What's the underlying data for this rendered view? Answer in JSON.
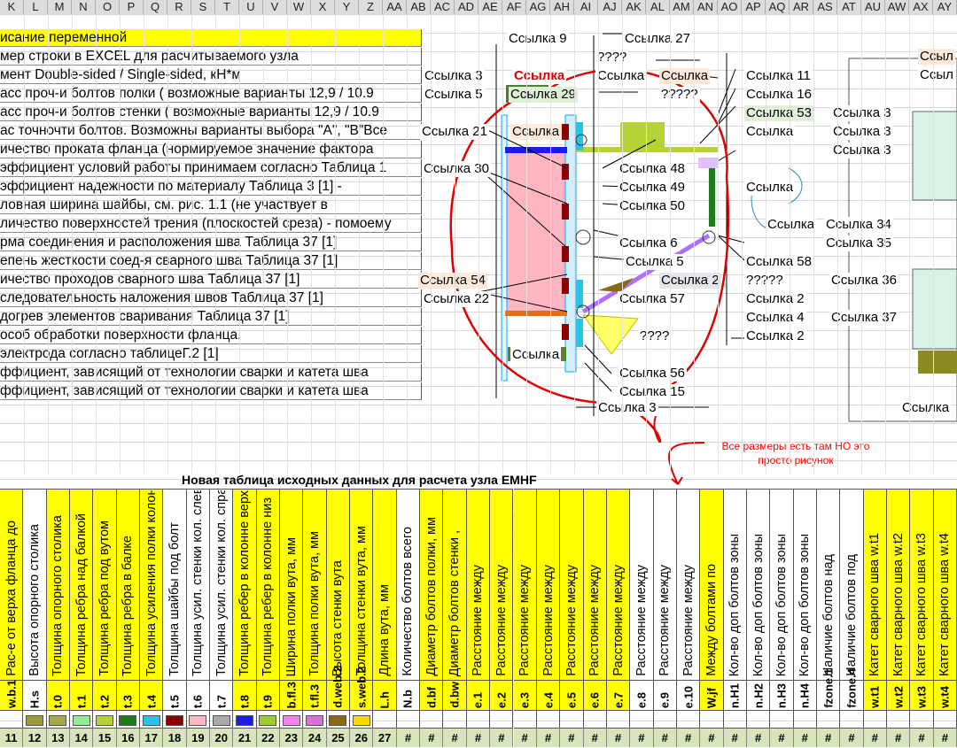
{
  "columns": [
    "K",
    "L",
    "M",
    "N",
    "O",
    "P",
    "Q",
    "R",
    "S",
    "T",
    "U",
    "V",
    "W",
    "X",
    "Y",
    "Z",
    "AA",
    "AB",
    "AC",
    "AD",
    "AE",
    "AF",
    "AG",
    "AH",
    "AI",
    "AJ",
    "AK",
    "AL",
    "AM",
    "AN",
    "AO",
    "AP",
    "AQ",
    "AR",
    "AS",
    "AT",
    "AU",
    "AW",
    "AX",
    "AY"
  ],
  "descriptions": [
    "исание переменной",
    "мер строки в EXCEL для расчитываемого узла",
    "мент Double-sided / Single-sided, кН*м",
    "асс проч-и болтов полки ( возможные варианты 12,9 / 10.9",
    "асс проч-и болтов стенки ( возможные варианты 12,9 / 10.9",
    "ас точночти болтов. Возможны варианты выбора \"A\", \"B\"Все",
    "ичество проката фланца (нормируемое значение фактора",
    "эффициент условий работы принимаем согласно Таблица 1",
    "эффициент надежности по материалу Таблица 3 [1] -",
    "ловная ширина шайбы, см. рис. 1.1 (не участвует в",
    "личество поверхностей трения (плоскостей среза) - помоему",
    "рма соединения и расположения  шва Таблица 37 [1]",
    "епень жесткости соед-я сварного шва Таблица 37 [1]",
    "ичество проходов сварного шва Таблица 37 [1]",
    "следовательность наложения швов Таблица 37 [1]",
    "догрев элементов сваривания Таблица 37 [1]",
    "особ обработки поверхности фланца.",
    " электрода согласно таблицеГ.2 [1]",
    "ффициент, зависящий от технологии сварки и катета шва",
    "ффициент, зависящий от технологии сварки и катета шва"
  ],
  "drawing_labels": {
    "l1": "Ссылка 9",
    "l2": "Ссылка 27",
    "l3": "????",
    "l4": "Ссылка 3",
    "l5": "Ссылка",
    "l6": "Ссылка",
    "l7": "Ссылка",
    "l8": "Ссылка 11",
    "l9": "Ссылка 5",
    "l10": "Ссылка 29",
    "l11": "?????",
    "l12": "Ссылка 16",
    "l13": "Ссылка 53",
    "l14": "Ссылка 21",
    "l15": "Ссылка",
    "l16": "Ссылка",
    "l17": "Ссылка 30",
    "l18": "Ссылка 48",
    "l19": "Ссылка 49",
    "l20": "Ссылка",
    "l21": "Ссылка 50",
    "l22": "Ссылка",
    "l23": "Ссылка 6",
    "l24": "Ссылка 5",
    "l25": "Ссылка 58",
    "l26": "Ссылка 54",
    "l27": "Ссылка 2",
    "l28": "?????",
    "l29": "Ссылка 22",
    "l30": "Ссылка 57",
    "l31": "Ссылка 2",
    "l32": "Ссылка 4",
    "l33": "????",
    "l34": "Ссылка 2",
    "l35": "Ссылка",
    "l36": "Ссылка 56",
    "l37": "Ссылка 15",
    "l38": "Ссылка 3",
    "r1": "Ссыл",
    "r2": "Ссыл",
    "r3": "Ссылка 3",
    "r4": "Ссылка 3",
    "r5": "Ссылка 3",
    "r6": "Ссылка 34",
    "r7": "Ссылка 35",
    "r8": "Ссылка 36",
    "r9": "Ссылка 37",
    "r10": "Ссылка"
  },
  "note": "Все размеры есть там НО это просто рисунок",
  "table_title": "Новая таблица исходных данных для расчета узла EMHF",
  "table_columns": [
    {
      "header": "Рас-е от верха фланца до",
      "code": "w.b.1",
      "bg": "#ffff00",
      "swatch": "",
      "num": "11"
    },
    {
      "header": "Высота опорного столика",
      "code": "H.s",
      "bg": "#ffffff",
      "swatch": "#9c9c3c",
      "num": "12"
    },
    {
      "header": "Толщина опорного столика",
      "code": "t.0",
      "bg": "#ffff00",
      "swatch": "#a6a64a",
      "num": "13"
    },
    {
      "header": "Толщина ребра над балкой",
      "code": "t.1",
      "bg": "#ffff00",
      "swatch": "#90ee90",
      "num": "14"
    },
    {
      "header": "Толщина ребра под вутом",
      "code": "t.2",
      "bg": "#ffff00",
      "swatch": "#b5d334",
      "num": "15"
    },
    {
      "header": "Толщина ребра в балке",
      "code": "t.3",
      "bg": "#ffff00",
      "swatch": "#1e7b1e",
      "num": "16"
    },
    {
      "header": "Толщина усиления полки колонны",
      "code": "t.4",
      "bg": "#ffff00",
      "swatch": "#27c4e8",
      "num": "17"
    },
    {
      "header": "Толщина шайбы под болт",
      "code": "t.5",
      "bg": "#ffffff",
      "swatch": "#8b0000",
      "num": "18"
    },
    {
      "header": "Толщина усил. стенки кол. слева",
      "code": "t.6",
      "bg": "#ffffff",
      "swatch": "#ffb6c1",
      "num": "19"
    },
    {
      "header": "Толщина усил. стенки кол. справа",
      "code": "t.7",
      "bg": "#ffffff",
      "swatch": "#a9a9a9",
      "num": "20"
    },
    {
      "header": "Толщина ребер в колонне верх",
      "code": "t.8",
      "bg": "#ffff00",
      "swatch": "#1c1ce8",
      "num": "21"
    },
    {
      "header": "Толщина ребер в колонне низ",
      "code": "t.9",
      "bg": "#ffff00",
      "swatch": "#9acd32",
      "num": "22"
    },
    {
      "header": "Ширина полки вута, мм",
      "code": "b.fl.3",
      "bg": "#ffff00",
      "swatch": "#ee82ee",
      "num": "23"
    },
    {
      "header": "Толщина полки вута, мм",
      "code": "t.fl.3",
      "bg": "#ffff00",
      "swatch": "#da70d6",
      "num": "24"
    },
    {
      "header": "Высота стенки вута",
      "code": "d.web.2",
      "bg": "#ffff00",
      "swatch": "#8b6914",
      "num": "25"
    },
    {
      "header": "Толщина стенки вута, мм",
      "code": "s.web.2",
      "bg": "#ffff00",
      "swatch": "#ffd700",
      "num": "26"
    },
    {
      "header": "Длина вута, мм",
      "code": "L.h",
      "bg": "#ffff00",
      "swatch": "",
      "num": "27"
    },
    {
      "header": "Количество болтов всего",
      "code": "N.b",
      "bg": "#ffffff",
      "swatch": "",
      "num": "#"
    },
    {
      "header": "Диаметр болтов полки, мм",
      "code": "d.bf",
      "bg": "#ffff00",
      "swatch": "",
      "num": "#"
    },
    {
      "header": "Диаметр болтов стенки ,",
      "code": "d.bw",
      "bg": "#ffff00",
      "swatch": "",
      "num": "#"
    },
    {
      "header": "Расстояние между",
      "code": "e.1",
      "bg": "#ffff00",
      "swatch": "",
      "num": "#"
    },
    {
      "header": "Расстояние между",
      "code": "e.2",
      "bg": "#ffff00",
      "swatch": "",
      "num": "#"
    },
    {
      "header": "Расстояние между",
      "code": "e.3",
      "bg": "#ffff00",
      "swatch": "",
      "num": "#"
    },
    {
      "header": "Расстояние между",
      "code": "e.4",
      "bg": "#ffff00",
      "swatch": "",
      "num": "#"
    },
    {
      "header": "Расстояние между",
      "code": "e.5",
      "bg": "#ffff00",
      "swatch": "",
      "num": "#"
    },
    {
      "header": "Расстояние между",
      "code": "e.6",
      "bg": "#ffff00",
      "swatch": "",
      "num": "#"
    },
    {
      "header": "Расстояние между",
      "code": "e.7",
      "bg": "#ffff00",
      "swatch": "",
      "num": "#"
    },
    {
      "header": "Расстояние между",
      "code": "e.8",
      "bg": "#ffffff",
      "swatch": "",
      "num": "#"
    },
    {
      "header": "Расстояние между",
      "code": "e.9",
      "bg": "#ffffff",
      "swatch": "",
      "num": "#"
    },
    {
      "header": "Расстояние между",
      "code": "e.10",
      "bg": "#ffffff",
      "swatch": "",
      "num": "#"
    },
    {
      "header": "Между болтами по",
      "code": "W.jf",
      "bg": "#ffff00",
      "swatch": "",
      "num": "#"
    },
    {
      "header": "Кол-во доп болтов зоны",
      "code": "n.H1",
      "bg": "#ffffff",
      "swatch": "",
      "num": "#"
    },
    {
      "header": "Кол-во доп болтов зоны",
      "code": "n.H2",
      "bg": "#ffffff",
      "swatch": "",
      "num": "#"
    },
    {
      "header": "Кол-во доп болтов зоны",
      "code": "n.H3",
      "bg": "#ffffff",
      "swatch": "",
      "num": "#"
    },
    {
      "header": "Кол-во доп болтов зоны",
      "code": "n.H4",
      "bg": "#ffffff",
      "swatch": "",
      "num": "#"
    },
    {
      "header": "Наличие болтов над",
      "code": "fzone.1",
      "bg": "#ffffff",
      "swatch": "",
      "num": "#"
    },
    {
      "header": "Наличие болтов под",
      "code": "fzone.4",
      "bg": "#ffffff",
      "swatch": "",
      "num": "#"
    },
    {
      "header": "Катет сварного шва  w.t1",
      "code": "w.t1",
      "bg": "#ffff00",
      "swatch": "",
      "num": "#"
    },
    {
      "header": "Катет сварного шва  w.t2",
      "code": "w.t2",
      "bg": "#ffff00",
      "swatch": "",
      "num": "#"
    },
    {
      "header": "Катет сварного шва  w.t3",
      "code": "w.t3",
      "bg": "#ffff00",
      "swatch": "",
      "num": "#"
    },
    {
      "header": "Катет сварного шва  w.t4",
      "code": "w.t4",
      "bg": "#ffff00",
      "swatch": "",
      "num": "#"
    }
  ]
}
